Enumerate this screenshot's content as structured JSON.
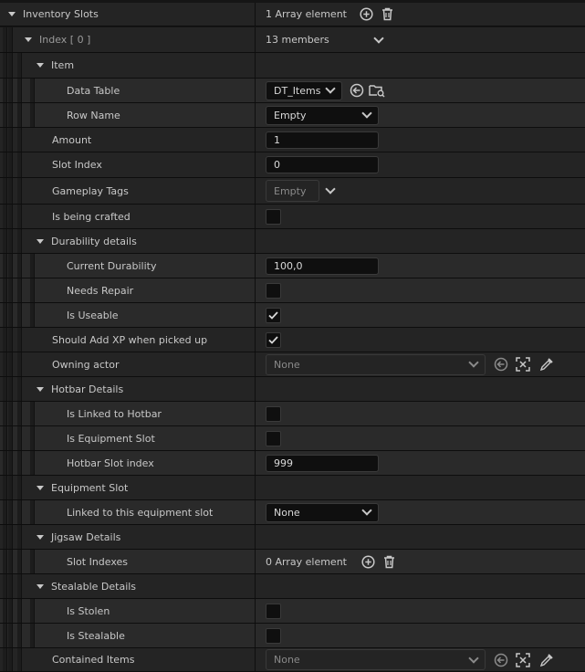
{
  "inventory": {
    "label": "Inventory Slots",
    "count": "1 Array element"
  },
  "index0": {
    "label": "Index [ 0 ]",
    "members": "13 members"
  },
  "item": {
    "label": "Item",
    "data_table_label": "Data Table",
    "data_table_value": "DT_Items",
    "row_name_label": "Row Name",
    "row_name_value": "Empty"
  },
  "amount": {
    "label": "Amount",
    "value": "1"
  },
  "slot_index": {
    "label": "Slot Index",
    "value": "0"
  },
  "gameplay_tags": {
    "label": "Gameplay Tags",
    "value": "Empty"
  },
  "is_being_crafted": {
    "label": "Is being crafted",
    "checked": false
  },
  "durability": {
    "label": "Durability details",
    "current_label": "Current Durability",
    "current_value": "100,0",
    "needs_repair_label": "Needs Repair",
    "needs_repair": false,
    "is_useable_label": "Is Useable",
    "is_useable": true
  },
  "add_xp": {
    "label": "Should Add XP when picked up",
    "checked": true
  },
  "owning_actor": {
    "label": "Owning actor",
    "value": "None"
  },
  "hotbar": {
    "label": "Hotbar Details",
    "linked_label": "Is Linked to Hotbar",
    "linked": false,
    "equipment_label": "Is Equipment Slot",
    "equipment": false,
    "slot_index_label": "Hotbar Slot index",
    "slot_index_value": "999"
  },
  "equipment_slot": {
    "label": "Equipment Slot",
    "linked_label": "Linked to this equipment slot",
    "linked_value": "None"
  },
  "jigsaw": {
    "label": "Jigsaw Details",
    "slot_indexes_label": "Slot Indexes",
    "slot_indexes_value": "0 Array element"
  },
  "stealable": {
    "label": "Stealable Details",
    "is_stolen_label": "Is Stolen",
    "is_stolen": false,
    "is_stealable_label": "Is Stealable",
    "is_stealable": false
  },
  "contained_items": {
    "label": "Contained Items",
    "value": "None"
  },
  "icons": [
    "add-circle-icon",
    "trash-icon",
    "chevron-down-icon",
    "browse-arrow-icon",
    "folder-search-icon",
    "use-selected-icon",
    "pick-actor-icon",
    "eyedropper-icon",
    "checkmark-icon"
  ],
  "colors": {
    "background": "#151515",
    "row": "#242424",
    "field": "#0f0f0f",
    "text": "#c8c8c8"
  }
}
